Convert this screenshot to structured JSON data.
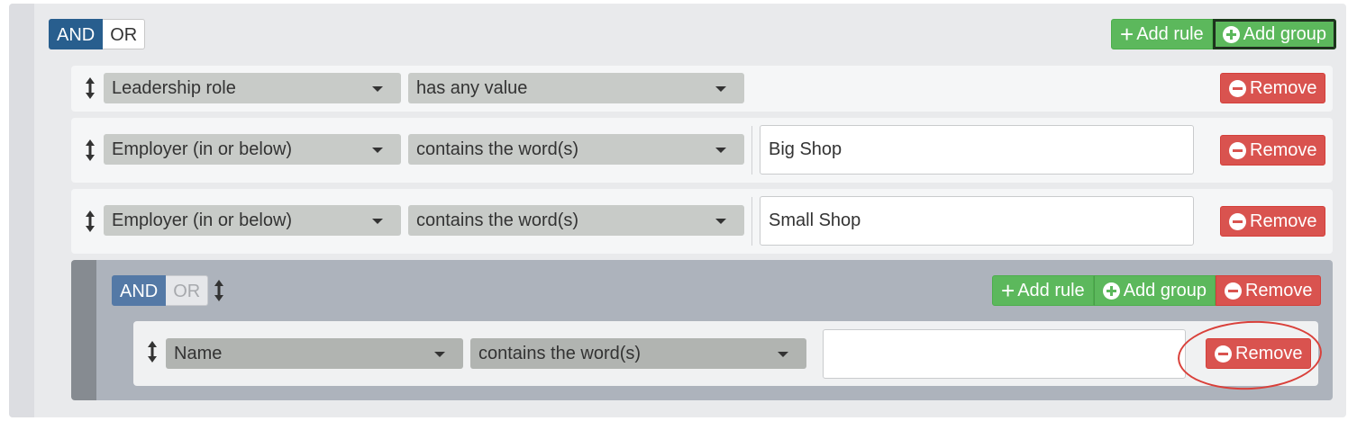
{
  "root_group": {
    "condition": {
      "and_label": "AND",
      "or_label": "OR",
      "selected": "AND"
    },
    "add_rule_label": "Add rule",
    "add_group_label": "Add group",
    "rules": [
      {
        "field": "Leadership role",
        "operator": "has any value",
        "value": null,
        "remove_label": "Remove"
      },
      {
        "field": "Employer (in or below)",
        "operator": "contains the word(s)",
        "value": "Big Shop",
        "remove_label": "Remove"
      },
      {
        "field": "Employer (in or below)",
        "operator": "contains the word(s)",
        "value": "Small Shop",
        "remove_label": "Remove"
      }
    ],
    "nested_group": {
      "condition": {
        "and_label": "AND",
        "or_label": "OR",
        "selected": "AND"
      },
      "add_rule_label": "Add rule",
      "add_group_label": "Add group",
      "remove_label": "Remove",
      "rules": [
        {
          "field": "Name",
          "operator": "contains the word(s)",
          "value": "",
          "remove_label": "Remove"
        }
      ]
    }
  },
  "colors": {
    "and_active": "#285e8e",
    "success": "#5cb85c",
    "danger": "#d9534f",
    "highlight": "#d9403a"
  },
  "icons": [
    "drag-handle-icon",
    "caret-down-icon",
    "plus-icon",
    "plus-circle-icon",
    "minus-circle-icon"
  ]
}
